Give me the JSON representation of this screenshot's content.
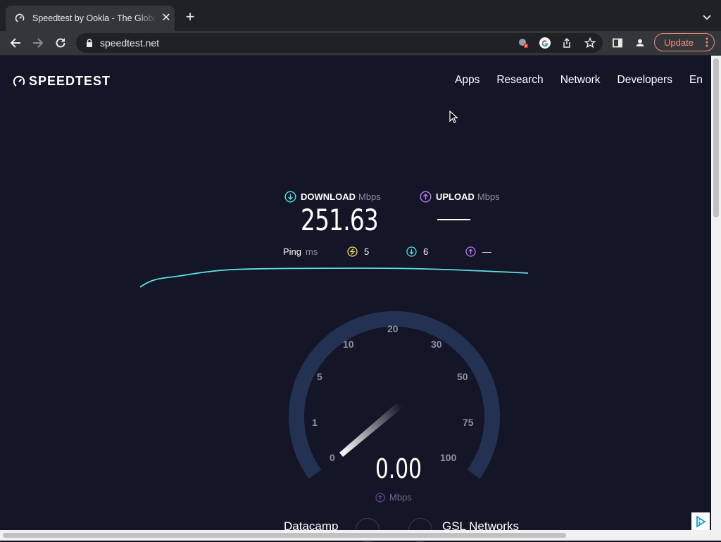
{
  "browser": {
    "tab_title": "Speedtest by Ookla - The Global Broadband Speed Test",
    "url": "speedtest.net",
    "update_label": "Update"
  },
  "site": {
    "logo_text": "SPEEDTEST",
    "nav": [
      "Apps",
      "Research",
      "Network",
      "Developers",
      "En"
    ]
  },
  "results": {
    "download_label": "DOWNLOAD",
    "download_unit": "Mbps",
    "download_value": "251.63",
    "upload_label": "UPLOAD",
    "upload_unit": "Mbps",
    "ping_label": "Ping",
    "ping_unit": "ms",
    "ping_idle": "5",
    "ping_download": "6",
    "ping_upload": "—"
  },
  "gauge": {
    "scale": [
      "0",
      "1",
      "5",
      "10",
      "20",
      "30",
      "50",
      "75",
      "100"
    ],
    "current_value": "0.00",
    "unit": "Mbps"
  },
  "servers": {
    "host": "Datacamp",
    "provider": "GSL Networks"
  },
  "colors": {
    "background": "#141526",
    "download_accent": "#5ce1e6",
    "upload_accent": "#b87cf5",
    "ping_accent": "#f3e45c",
    "gauge_track": "#233153"
  }
}
